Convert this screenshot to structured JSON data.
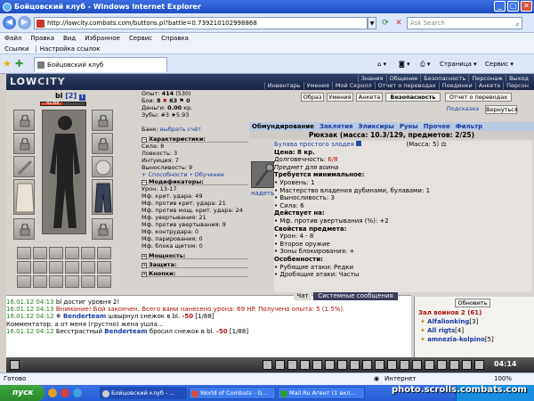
{
  "window": {
    "title": "Бойцовский клуб - Windows Internet Explorer"
  },
  "address": {
    "url": "http://lowcity.combats.com/buttons.pl?battle=0.739210102998868",
    "search_placeholder": "Ask Search"
  },
  "menu": [
    "Файл",
    "Правка",
    "Вид",
    "Избранное",
    "Сервис",
    "Справка"
  ],
  "links": {
    "label": "Ссылки",
    "item": "Настройка ссылок"
  },
  "tab": {
    "title": "Бойцовский клуб"
  },
  "toolbar": {
    "page": "Страница",
    "service": "Сервис"
  },
  "game": {
    "logo": {
      "low": "LOW",
      "city": "CITY"
    },
    "nav1": [
      "Знания",
      "Общение",
      "Безопасность",
      "Персонаж",
      "Выход"
    ],
    "nav2": [
      "Инвентарь",
      "Умения",
      "Мой Скролл",
      "Отчет о переводах",
      "Поединки",
      "Анкета",
      "Персон"
    ],
    "char": {
      "name": "bl",
      "level": "[2]",
      "hp": "41/88",
      "bx": "i"
    },
    "topbuttons": [
      "Образ",
      "Умения",
      "Анкета",
      "Безопасность",
      "Отчет о переводах",
      "Подсказка",
      "Вернуться"
    ],
    "stats": {
      "exp_label": "Опыт:",
      "exp": "414",
      "exp_next": "(530)",
      "wins_label": "Бои:",
      "wins": "8",
      "losses": "63",
      "draws": "0",
      "money_label": "Деньги:",
      "money": "0.00",
      "money_unit": "кр.",
      "teeth_label": "Зубы:",
      "teeth": "#3 ★5.93",
      "bank": "Банк:",
      "bank_link": "выбрать счёт",
      "char_hdr": "Характеристики:",
      "str": "Сила: 8",
      "agi": "Ловкость: 3",
      "int": "Интуиция: 7",
      "vyn": "Выносливость: 9",
      "links": "+ Способности • Обучение",
      "mod_hdr": "Модификаторы:",
      "uron": "Урон: 13-17",
      "mods": [
        "Мф. крит. удара: 49",
        "Мф. против крит. удара: 21",
        "Мф. против мощ. крит. удара: 24",
        "Мф. увертывания: 21",
        "Мф. против увертывания: 9",
        "Мф. контрудара: 0",
        "Мф. парирования: 0",
        "Мф. блока щитом: 0"
      ],
      "power_hdr": "Мощность:",
      "def_hdr": "Защита:",
      "btn_hdr": "Кнопки:"
    },
    "shop": {
      "tabs": [
        "Обмундирование",
        "Заклятия",
        "Эликсиры",
        "Руны",
        "Прочее",
        "Фильтр"
      ],
      "bag": "Рюкзак (масса: 10.3/129, предметов: 2/25)",
      "item_name": "Булава простого злодея",
      "item_mass": "(Масса: 5)",
      "price": "Цена: 8 кр.",
      "durability_label": "Долговечность:",
      "durability": "6/8",
      "for_warrior": "Предмет для воина",
      "req_hdr": "Требуется минимальное:",
      "req": [
        "• Уровень: 1",
        "• Мастерство владения дубинами, булавами: 1",
        "• Выносливость: 3",
        "• Сила: 6"
      ],
      "acts_hdr": "Действует на:",
      "acts": [
        "• Мф. против увертывания (%): +2"
      ],
      "props_hdr": "Свойства предмета:",
      "props": [
        "• Урон: 4 - 8",
        "• Второе оружие",
        "• Зоны блокирования: +"
      ],
      "feat_hdr": "Особенности:",
      "feats": [
        "• Рубящие атаки: Редки",
        "• Дробящие атаки: Часты"
      ],
      "wear": "надеть"
    },
    "chat": [
      {
        "time": "16.01.12 04:13",
        "text": "bl достиг уровня 2!"
      },
      {
        "time": "16.01.12 04:13",
        "text": "Внимание! Бой закончен. Всего вами нанесено урона: 69 HP. Получено опыта: 5 (1.5%)."
      },
      {
        "time": "16.01.12 04:12",
        "name": "Benderteam",
        "text": "швырнул снежок в bl.",
        "dmg": "-50",
        "rest": "[1/88]"
      },
      {
        "text": "Комментатор: а от меня (грустно) жена ушла..."
      },
      {
        "time": "16.01.12 04:12",
        "pre": "Бесстрастный",
        "name": "Benderteam",
        "text": "бросил снежок в bl.",
        "dmg": "-50",
        "rest": "[1/88]"
      }
    ],
    "chattab": "Чат",
    "chattab2": "Системные сообщения",
    "room": {
      "refresh": "Обновить",
      "title": "Зал воинов 2",
      "count": "(61)",
      "users": [
        {
          "name": "Alfalionking",
          "lvl": "[3]"
        },
        {
          "name": "All rigts",
          "lvl": "[4]"
        },
        {
          "name": "amnezia-kolpino",
          "lvl": "[5]"
        }
      ]
    },
    "clock": "04:14"
  },
  "status": {
    "ready": "Готово",
    "zone": "Интернет",
    "zoom": "100%"
  },
  "taskbar": {
    "start": "пуск",
    "tasks": [
      "Бойцовский клуб - ...",
      "World of Combats - G...",
      "Mail.Ru Агент (1 вкл..."
    ],
    "watermark": "photo.scrolls.combats.com"
  }
}
